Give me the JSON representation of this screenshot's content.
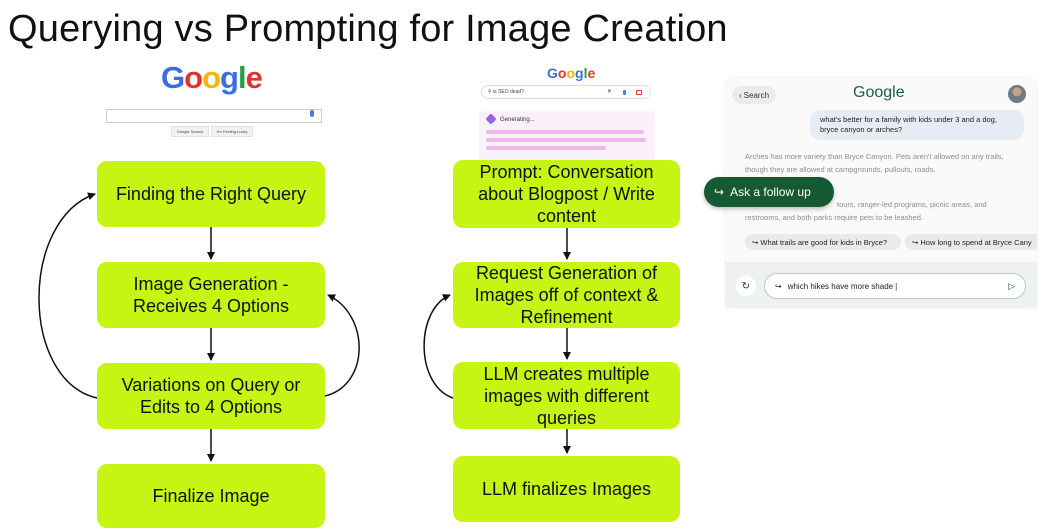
{
  "title": "Querying vs Prompting for Image Creation",
  "left_mock": {
    "logo_letters": [
      {
        "ch": "G",
        "color": "#3b6fe0"
      },
      {
        "ch": "o",
        "color": "#e0352b"
      },
      {
        "ch": "o",
        "color": "#f4b400"
      },
      {
        "ch": "g",
        "color": "#3b6fe0"
      },
      {
        "ch": "l",
        "color": "#2a9a47"
      },
      {
        "ch": "e",
        "color": "#e0352b"
      }
    ],
    "btn_search": "Google Search",
    "btn_lucky": "I'm Feeling Lucky"
  },
  "left_flow": {
    "steps": [
      "Finding the Right Query",
      "Image Generation - Receives 4 Options",
      "Variations on Query or Edits to 4 Options",
      "Finalize Image"
    ]
  },
  "mid_mock": {
    "logo_letters": [
      {
        "ch": "G",
        "color": "#3b6fe0"
      },
      {
        "ch": "o",
        "color": "#e0352b"
      },
      {
        "ch": "o",
        "color": "#f4b400"
      },
      {
        "ch": "g",
        "color": "#3b6fe0"
      },
      {
        "ch": "l",
        "color": "#2a9a47"
      },
      {
        "ch": "e",
        "color": "#e0352b"
      }
    ],
    "search_text": "is SEO dead?",
    "generating": "Generating..."
  },
  "mid_flow": {
    "steps": [
      "Prompt: Conversation about Blogpost / Write content",
      "Request Generation of Images off of context & Refinement",
      "LLM creates multiple images with different queries",
      "LLM finalizes Images"
    ]
  },
  "right_mock": {
    "back": "Search",
    "logo": "Google",
    "query": "what's better for a family with kids under 3 and a dog, bryce canyon or arches?",
    "answer_1": "Arches has more variety than Bryce Canyon. Pets aren't allowed on any trails, though they are allowed at campgrounds, pullouts, roads,",
    "answer_2": "tours, ranger-led programs, picnic areas, and restrooms, and both parks require pets to be leashed.",
    "follow_up": "Ask a follow up",
    "chip_1": "What trails are good for kids in Bryce?",
    "chip_2": "How long to spend at Bryce Cany",
    "input_text": "which hikes have more shade",
    "accent": "#165a34"
  }
}
